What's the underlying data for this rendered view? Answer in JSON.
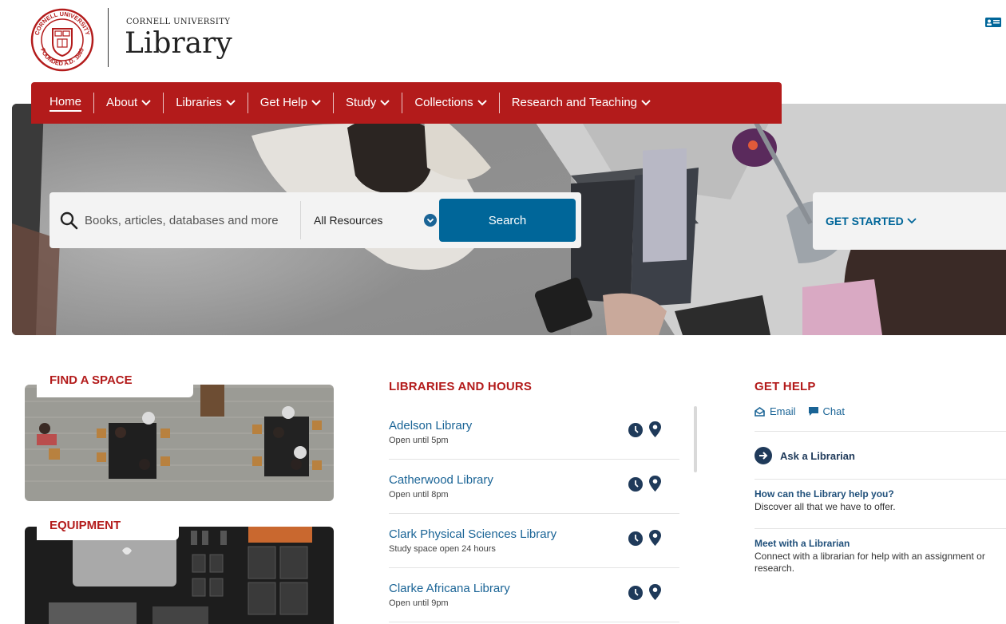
{
  "brand": {
    "university": "CORNELL UNIVERSITY",
    "name": "Library",
    "seal_text_top": "CORNELL UNIVERSITY",
    "seal_text_bottom": "FOUNDED A.D. 1865"
  },
  "nav": {
    "items": [
      {
        "label": "Home",
        "active": true,
        "dropdown": false
      },
      {
        "label": "About",
        "dropdown": true
      },
      {
        "label": "Libraries",
        "dropdown": true
      },
      {
        "label": "Get Help",
        "dropdown": true
      },
      {
        "label": "Study",
        "dropdown": true
      },
      {
        "label": "Collections",
        "dropdown": true
      },
      {
        "label": "Research and Teaching",
        "dropdown": true
      }
    ]
  },
  "search": {
    "placeholder": "Books, articles, databases and more",
    "scope": "All Resources",
    "button": "Search"
  },
  "get_started": {
    "label": "GET STARTED"
  },
  "cards": {
    "find_space": "FIND A SPACE",
    "equipment": "EQUIPMENT"
  },
  "libraries": {
    "title": "LIBRARIES AND HOURS",
    "items": [
      {
        "name": "Adelson Library",
        "status": "Open until 5pm"
      },
      {
        "name": "Catherwood Library",
        "status": "Open until 8pm"
      },
      {
        "name": "Clark Physical Sciences Library",
        "status": "Study space open 24 hours"
      },
      {
        "name": "Clarke Africana Library",
        "status": "Open until 9pm"
      }
    ]
  },
  "help": {
    "title": "GET HELP",
    "email": "Email",
    "chat": "Chat",
    "ask": "Ask a Librarian",
    "items": [
      {
        "title": "How can the Library help you?",
        "desc": "Discover all that we have to offer."
      },
      {
        "title": "Meet with a Librarian",
        "desc": "Connect with a librarian for help with an assignment or research."
      }
    ]
  },
  "colors": {
    "cornell_red": "#b31b1b",
    "link_blue": "#1a6496",
    "button_blue": "#006699"
  }
}
